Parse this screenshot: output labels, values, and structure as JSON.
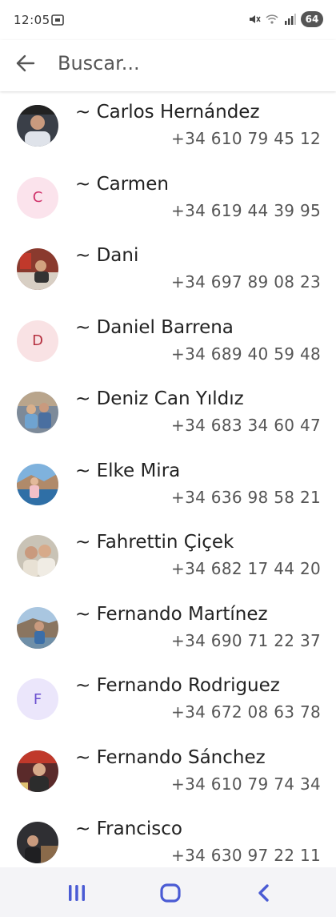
{
  "status_bar": {
    "time": "12:05",
    "battery": "64",
    "icons": [
      "screen-record-icon",
      "mute-icon",
      "wifi-icon",
      "signal-icon"
    ]
  },
  "app_bar": {
    "back_icon": "arrow-back-icon",
    "search_placeholder": "Buscar..."
  },
  "contacts": [
    {
      "name": "~ Carlos Hernández",
      "phone": "+34 610 79 45 12",
      "avatar": "photo"
    },
    {
      "name": "~ Carmen",
      "phone": "+34 619 44 39 95",
      "avatar": "letter",
      "letter": "C",
      "color": "#d0326a"
    },
    {
      "name": "~ Dani",
      "phone": "+34 697 89 08 23",
      "avatar": "photo"
    },
    {
      "name": "~ Daniel Barrena",
      "phone": "+34 689 40 59 48",
      "avatar": "letter",
      "letter": "D",
      "color": "#b5303f"
    },
    {
      "name": "~ Deniz Can Yıldız",
      "phone": "+34 683 34 60 47",
      "avatar": "photo"
    },
    {
      "name": "~ Elke Mira",
      "phone": "+34 636 98 58 21",
      "avatar": "photo"
    },
    {
      "name": "~ Fahrettin Çiçek",
      "phone": "+34 682 17 44 20",
      "avatar": "photo"
    },
    {
      "name": "~ Fernando Martínez",
      "phone": "+34 690 71 22 37",
      "avatar": "photo"
    },
    {
      "name": "~ Fernando Rodriguez",
      "phone": "+34 672 08 63 78",
      "avatar": "letter",
      "letter": "F",
      "color": "#6a4fd0"
    },
    {
      "name": "~ Fernando Sánchez",
      "phone": "+34 610 79 74 34",
      "avatar": "photo"
    },
    {
      "name": "~ Francisco",
      "phone": "+34 630 97 22 11",
      "avatar": "photo"
    }
  ],
  "nav_bar": {
    "icons": [
      "recent-apps-icon",
      "home-icon",
      "back-icon"
    ],
    "color": "#4a5bd4"
  }
}
